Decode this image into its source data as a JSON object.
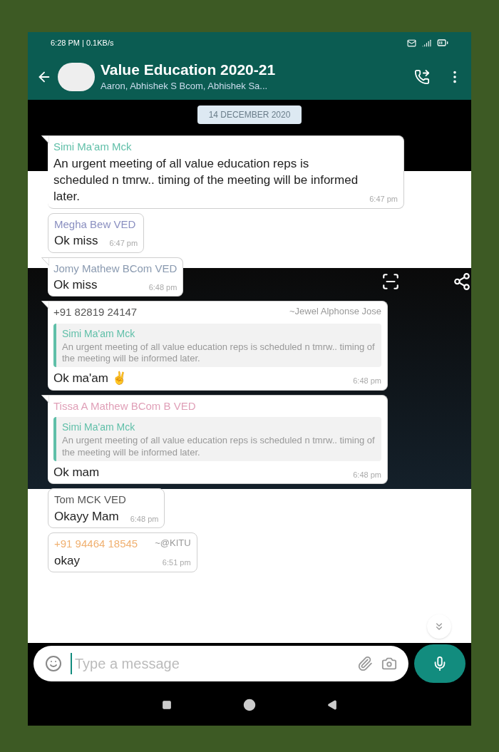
{
  "status_bar": {
    "time_info": "6:28 PM | 0.1KB/s"
  },
  "header": {
    "title": "Value Education 2020-21",
    "subtitle": "Aaron, Abhishek S Bcom, Abhishek Sa..."
  },
  "date_chip": "14 DECEMBER 2020",
  "messages": [
    {
      "author": "Simi Ma'am Mck",
      "color": "#5fbfa8",
      "text": "An urgent meeting of all value education reps is scheduled n tmrw.. timing of the meeting will be informed later.",
      "time": "6:47 pm",
      "tail": true
    },
    {
      "author": "Megha Bew VED",
      "color": "#8a8fc0",
      "text": "Ok miss",
      "time": "6:47 pm",
      "tail": false
    },
    {
      "author": "Jomy Mathew BCom VED",
      "color": "#8a9ab0",
      "text": "Ok miss",
      "time": "6:48 pm",
      "tail": true
    },
    {
      "author": "+91 82819 24147",
      "color": "#555555",
      "note": "~Jewel Alphonse Jose",
      "quote": {
        "author": "Simi Ma'am Mck",
        "text": "An urgent meeting of all value education reps is scheduled n tmrw.. timing of the meeting will be informed later."
      },
      "text": "Ok ma'am ✌",
      "time": "6:48 pm",
      "tail": true
    },
    {
      "author": "Tissa A Mathew BCom B VED",
      "color": "#e0a0b8",
      "quote": {
        "author": "Simi Ma'am Mck",
        "text": "An urgent meeting of all value education reps is scheduled n tmrw.. timing of the meeting will be informed later."
      },
      "text": "Ok mam",
      "time": "6:48 pm",
      "tail": true
    },
    {
      "author": "Tom MCK VED",
      "color": "#555555",
      "text": "Okayy Mam",
      "time": "6:48 pm",
      "tail": false
    },
    {
      "author": "+91 94464 18545",
      "color": "#f0b070",
      "note": "~@KITU",
      "text": "okay",
      "time": "6:51 pm",
      "tail": false
    }
  ],
  "composer": {
    "placeholder": "Type a message"
  }
}
